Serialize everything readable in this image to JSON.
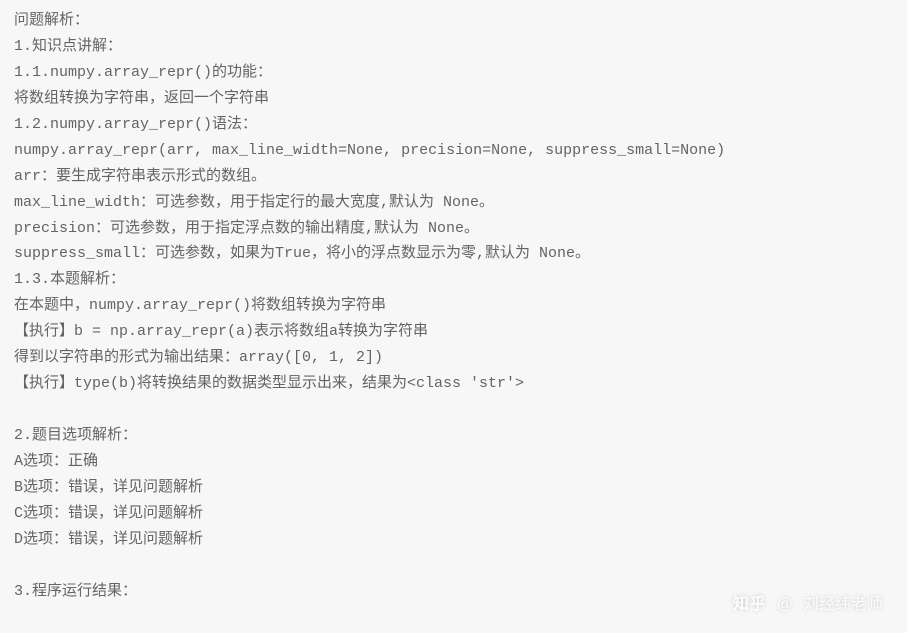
{
  "lines": [
    "问题解析：",
    "1.知识点讲解：",
    "1.1.numpy.array_repr()的功能：",
    "将数组转换为字符串，返回一个字符串",
    "1.2.numpy.array_repr()语法：",
    "numpy.array_repr(arr, max_line_width=None, precision=None, suppress_small=None)",
    "arr：要生成字符串表示形式的数组。",
    "max_line_width：可选参数，用于指定行的最大宽度,默认为 None。",
    "precision：可选参数，用于指定浮点数的输出精度,默认为 None。",
    "suppress_small：可选参数，如果为True，将小的浮点数显示为零,默认为 None。",
    "1.3.本题解析：",
    "在本题中，numpy.array_repr()将数组转换为字符串",
    "【执行】b = np.array_repr(a)表示将数组a转换为字符串",
    "得到以字符串的形式为输出结果：array([0, 1, 2])",
    "【执行】type(b)将转换结果的数据类型显示出来，结果为<class 'str'>",
    "",
    "2.题目选项解析：",
    "A选项：正确",
    "B选项：错误，详见问题解析",
    "C选项：错误，详见问题解析",
    "D选项：错误，详见问题解析",
    "",
    "3.程序运行结果："
  ],
  "watermark": {
    "brand": "知乎",
    "at": "@",
    "author": "刘经纬老师"
  }
}
